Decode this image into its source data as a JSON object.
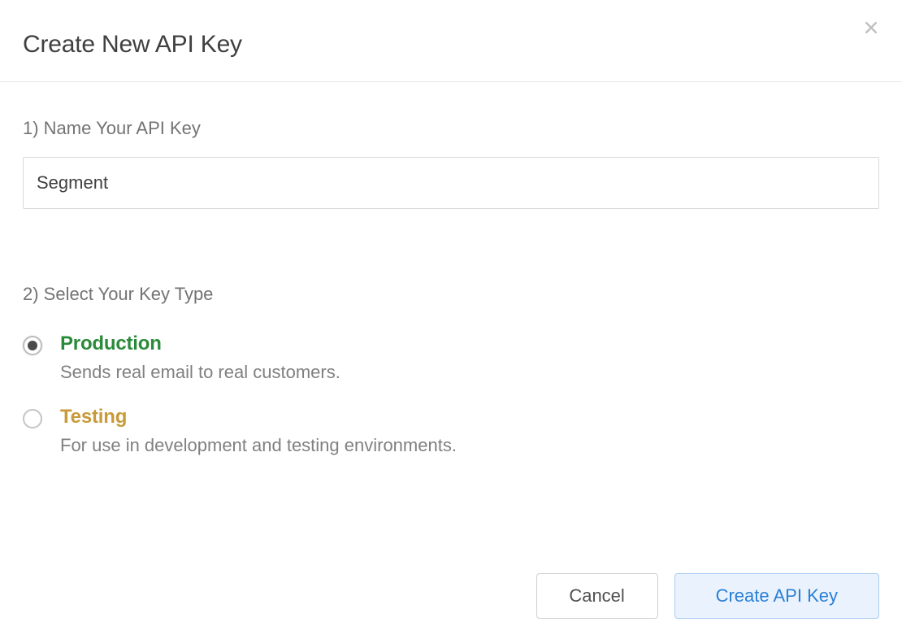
{
  "modal": {
    "title": "Create New API Key",
    "section1": {
      "label": "1) Name Your API Key",
      "input_value": "Segment"
    },
    "section2": {
      "label": "2) Select Your Key Type",
      "options": [
        {
          "title": "Production",
          "desc": "Sends real email to real customers.",
          "selected": true
        },
        {
          "title": "Testing",
          "desc": "For use in development and testing environments.",
          "selected": false
        }
      ]
    },
    "footer": {
      "cancel": "Cancel",
      "create": "Create API Key"
    }
  }
}
